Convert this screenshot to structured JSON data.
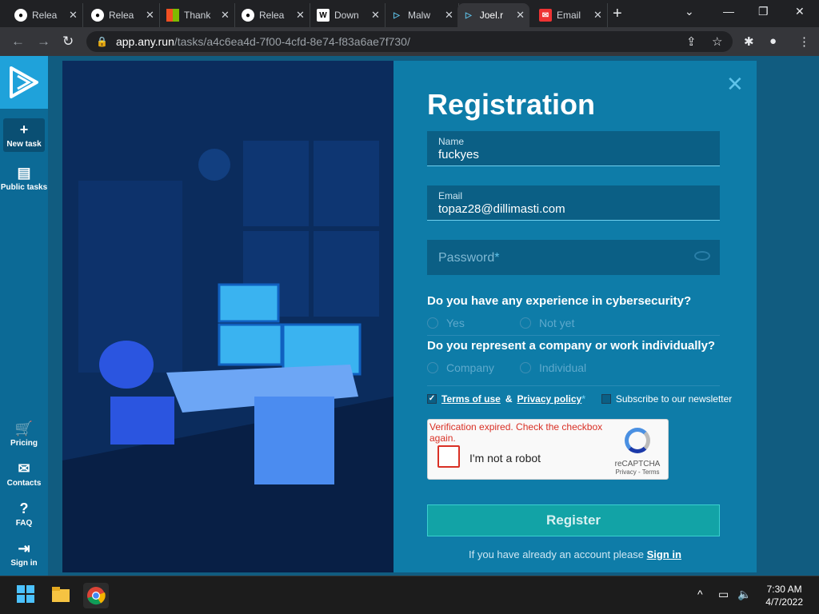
{
  "browser": {
    "tabs": [
      {
        "title": "Relea",
        "favicon": "github-icon"
      },
      {
        "title": "Relea",
        "favicon": "github-icon"
      },
      {
        "title": "Thank",
        "favicon": "microsoft-icon"
      },
      {
        "title": "Relea",
        "favicon": "github-icon"
      },
      {
        "title": "Down",
        "favicon": "word-icon"
      },
      {
        "title": "Malw",
        "favicon": "anyrun-icon"
      },
      {
        "title": "Joel.r",
        "favicon": "anyrun-icon",
        "active": true
      },
      {
        "title": "Email",
        "favicon": "email-icon"
      }
    ],
    "url_domain": "app.any.run",
    "url_path": "/tasks/a4c6ea4d-7f00-4cfd-8e74-f83a6ae7f730/"
  },
  "sidebar": {
    "new_task": "New task",
    "public_tasks": "Public tasks",
    "pricing": "Pricing",
    "contacts": "Contacts",
    "faq": "FAQ",
    "sign_in": "Sign in"
  },
  "form": {
    "title": "Registration",
    "name_label": "Name",
    "name_value": "fuckyes",
    "email_label": "Email",
    "email_value": "topaz28@dillimasti.com",
    "password_placeholder": "Password",
    "password_required": "*",
    "q1": "Do you have any experience in cybersecurity?",
    "q1_opt1": "Yes",
    "q1_opt2": "Not yet",
    "q2": "Do you represent a company or work individually?",
    "q2_opt1": "Company",
    "q2_opt2": "Individual",
    "terms_of_use": "Terms of use",
    "amp": "&",
    "privacy_policy": "Privacy policy",
    "terms_required": "*",
    "newsletter": "Subscribe to our newsletter",
    "recaptcha_error": "Verification expired. Check the checkbox again.",
    "recaptcha_text": "I'm not a robot",
    "recaptcha_brand": "reCAPTCHA",
    "recaptcha_links": "Privacy - Terms",
    "register_button": "Register",
    "signin_prompt": "If you have already an account please",
    "signin_link": "Sign in"
  },
  "taskbar": {
    "time": "7:30 AM",
    "date": "4/7/2022"
  }
}
